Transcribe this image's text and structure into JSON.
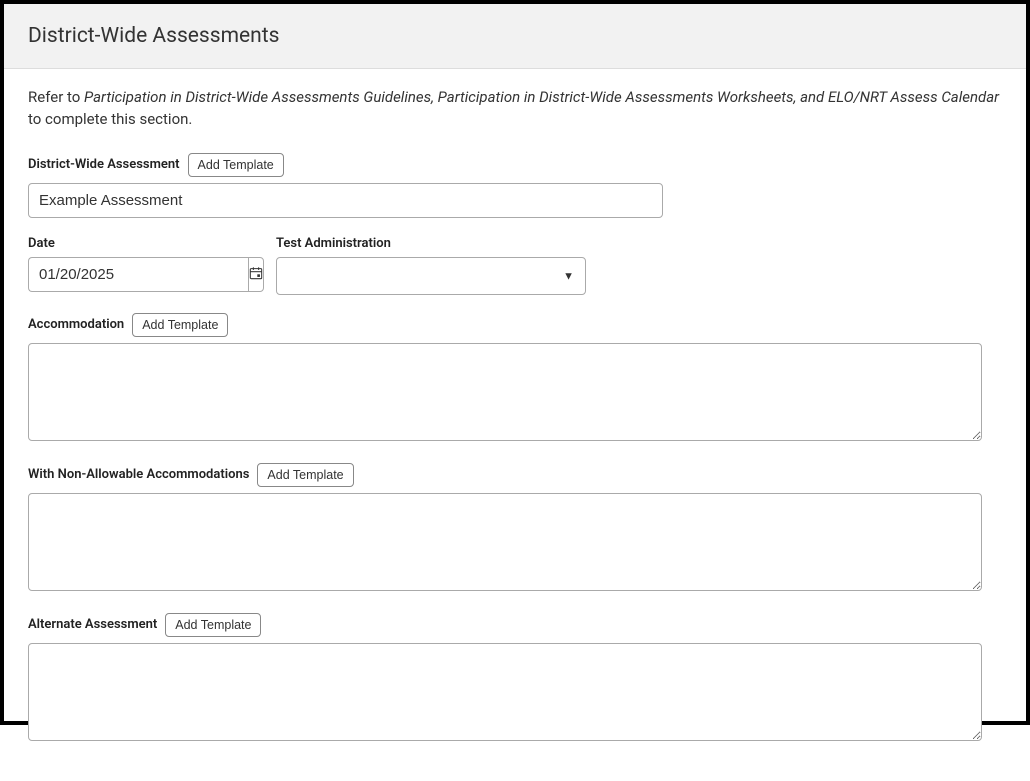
{
  "header": {
    "title": "District-Wide Assessments"
  },
  "intro": {
    "prefix": "Refer to ",
    "italic": "Participation in District-Wide Assessments Guidelines, Participation in District-Wide Assessments Worksheets, and ELO/NRT Assess Calendar",
    "suffix": " to complete this section."
  },
  "assessment": {
    "label": "District-Wide Assessment",
    "template_btn": "Add Template",
    "value": "Example Assessment"
  },
  "date": {
    "label": "Date",
    "value": "01/20/2025"
  },
  "testAdmin": {
    "label": "Test Administration",
    "value": ""
  },
  "accommodation": {
    "label": "Accommodation",
    "template_btn": "Add Template",
    "value": ""
  },
  "nonAllowable": {
    "label": "With Non-Allowable Accommodations",
    "template_btn": "Add Template",
    "value": ""
  },
  "alternate": {
    "label": "Alternate Assessment",
    "template_btn": "Add Template",
    "value": ""
  }
}
